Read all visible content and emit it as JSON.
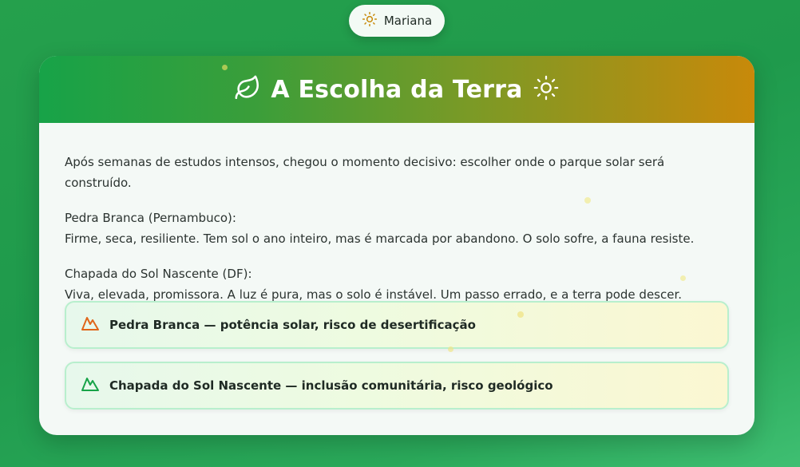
{
  "user": {
    "name": "Mariana",
    "icon": "sun-icon"
  },
  "card": {
    "title": "A Escolha da Terra",
    "title_icon_left": "leaf-icon",
    "title_icon_right": "sun-icon",
    "intro": "Após semanas de estudos intensos, chegou o momento decisivo: escolher onde o parque solar será construído.",
    "places": [
      {
        "name": "Pedra Branca (Pernambuco):",
        "description": "Firme, seca, resiliente. Tem sol o ano inteiro, mas é marcada por abandono. O solo sofre, a fauna resiste."
      },
      {
        "name": "Chapada do Sol Nascente (DF):",
        "description": "Viva, elevada, promissora. A luz é pura, mas o solo é instável. Um passo errado, e a terra pode descer."
      }
    ],
    "options": [
      {
        "label": "Pedra Branca — potência solar, risco de desertificação",
        "icon": "mountain-icon",
        "icon_color": "#e0661a"
      },
      {
        "label": "Chapada do Sol Nascente — inclusão comunitária, risco geológico",
        "icon": "mountain-icon",
        "icon_color": "#17a348"
      }
    ]
  },
  "colors": {
    "header_start": "#17a348",
    "header_end": "#c8890a",
    "background": "#22a04c"
  }
}
